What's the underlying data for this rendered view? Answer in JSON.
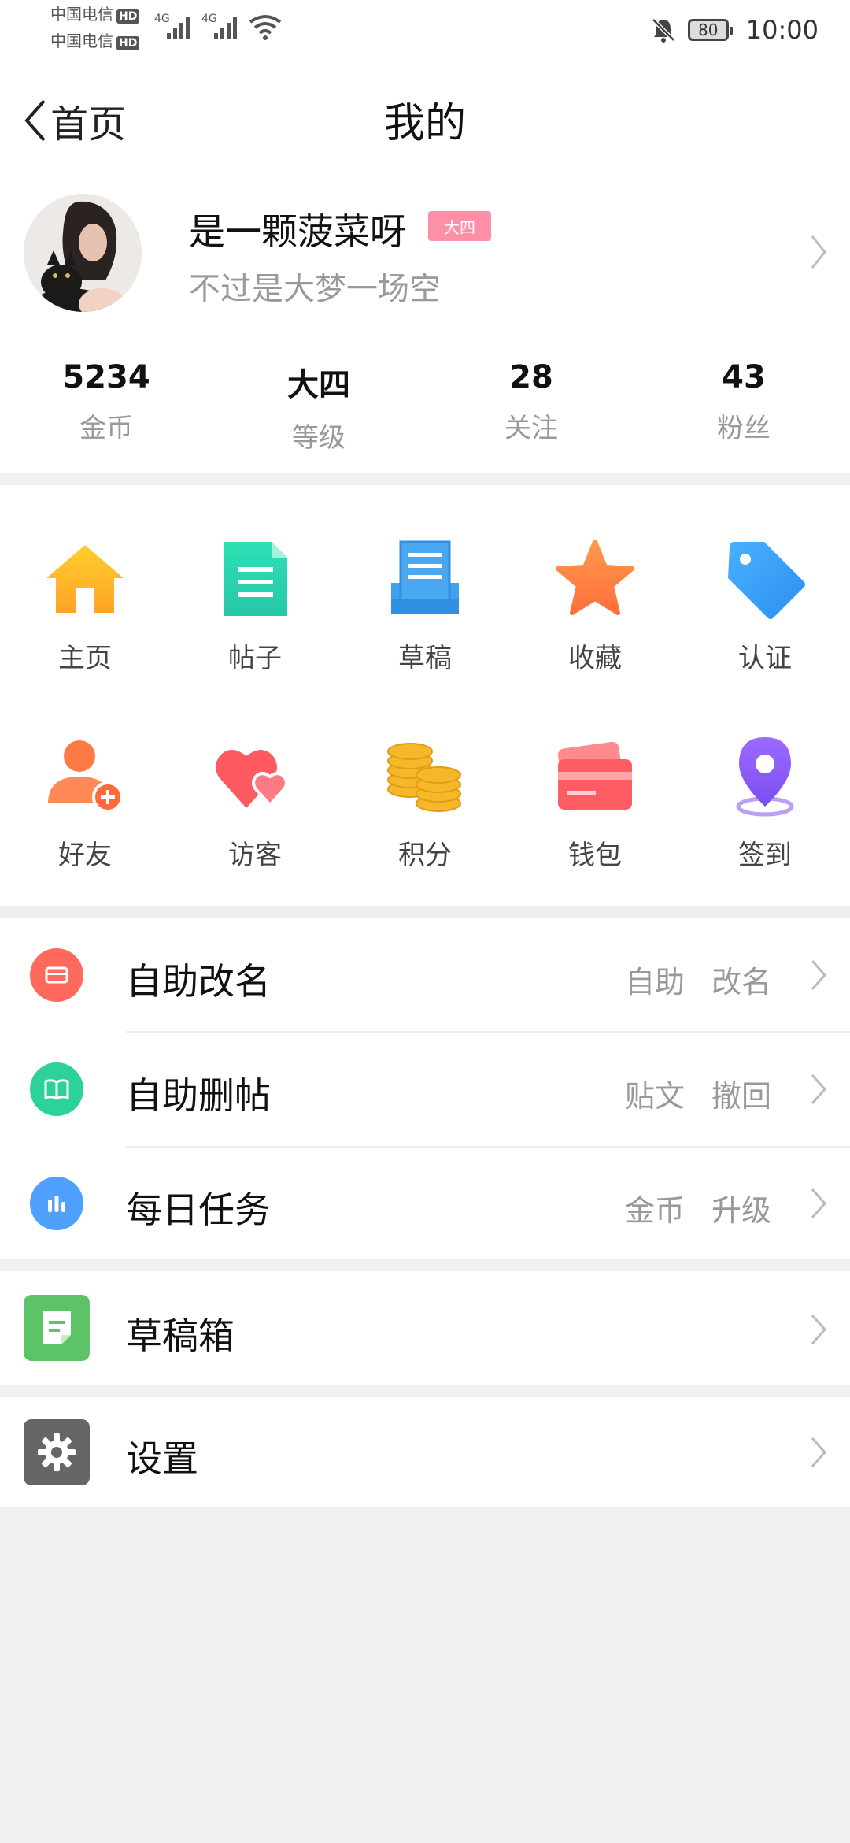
{
  "status_bar": {
    "carrier1": "中国电信",
    "carrier2": "中国电信",
    "hd": "HD",
    "net1": "4G",
    "net2": "4G",
    "battery": "80",
    "time": "10:00"
  },
  "nav": {
    "back_label": "首页",
    "title": "我的"
  },
  "profile": {
    "name": "是一颗菠菜呀",
    "level_badge": "大四",
    "bio": "不过是大梦一场空"
  },
  "stats": [
    {
      "value": "5234",
      "label": "金币"
    },
    {
      "value": "大四",
      "label": "等级"
    },
    {
      "value": "28",
      "label": "关注"
    },
    {
      "value": "43",
      "label": "粉丝"
    }
  ],
  "grid": [
    {
      "label": "主页",
      "icon": "home-icon"
    },
    {
      "label": "帖子",
      "icon": "document-icon"
    },
    {
      "label": "草稿",
      "icon": "draft-tray-icon"
    },
    {
      "label": "收藏",
      "icon": "star-icon"
    },
    {
      "label": "认证",
      "icon": "tag-icon"
    },
    {
      "label": "好友",
      "icon": "add-friend-icon"
    },
    {
      "label": "访客",
      "icon": "hearts-icon"
    },
    {
      "label": "积分",
      "icon": "coins-icon"
    },
    {
      "label": "钱包",
      "icon": "wallet-icon"
    },
    {
      "label": "签到",
      "icon": "location-pin-icon"
    }
  ],
  "list": [
    {
      "title": "自助改名",
      "tags": [
        "自助",
        "改名"
      ],
      "icon": "card-icon",
      "color": "#ff6a5c"
    },
    {
      "title": "自助删帖",
      "tags": [
        "贴文",
        "撤回"
      ],
      "icon": "book-icon",
      "color": "#2dd19a"
    },
    {
      "title": "每日任务",
      "tags": [
        "金币",
        "升级"
      ],
      "icon": "bar-chart-icon",
      "color": "#4fa0ff"
    }
  ],
  "draft_box": {
    "title": "草稿箱",
    "icon": "note-icon",
    "color": "#5cc466"
  },
  "settings": {
    "title": "设置",
    "icon": "gear-icon",
    "color": "#666666"
  }
}
